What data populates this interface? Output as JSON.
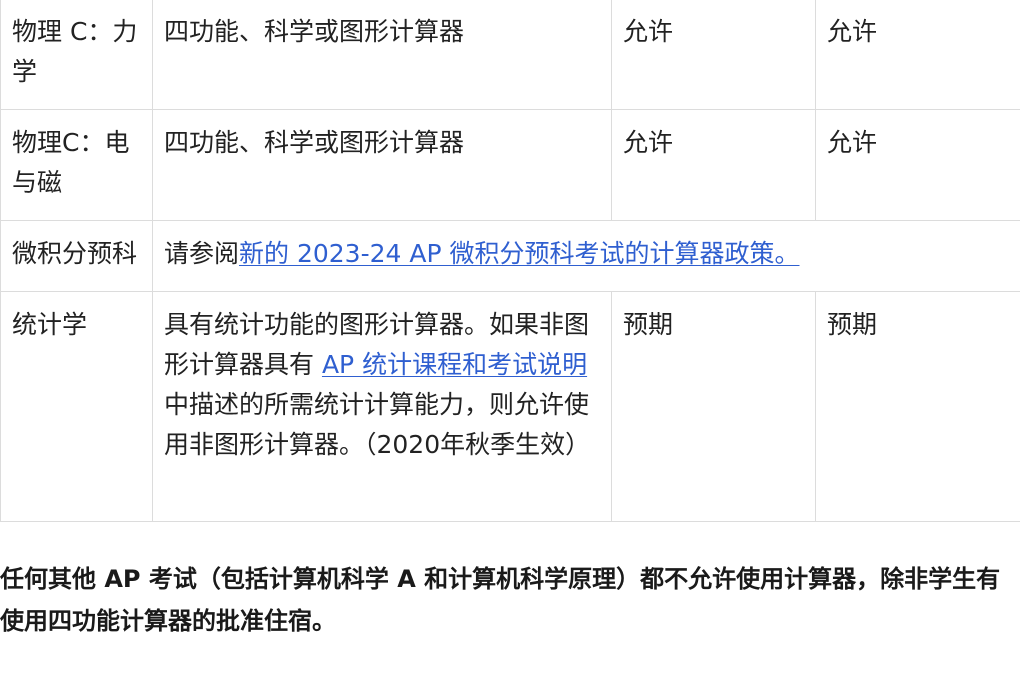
{
  "table": {
    "rows": [
      {
        "subject": "物理 C：力学",
        "calculator": "四功能、科学或图形计算器",
        "col3": "允许",
        "col4": "允许"
      },
      {
        "subject": "物理C：电与磁",
        "calculator": "四功能、科学或图形计算器",
        "col3": "允许",
        "col4": "允许"
      },
      {
        "subject": "微积分预科",
        "text_before": "请参阅",
        "link": "新的 2023-24 AP 微积分预科考试的计算器政策。"
      },
      {
        "subject": "统计学",
        "text_before": "具有统计功能的图形计算器。如果非图形计算器具有 ",
        "link": "AP 统计课程和考试说明",
        "text_after": "中描述的所需统计计算能力，则允许使用非图形计算器。（2020年秋季生效）",
        "col3": "预期",
        "col4": "预期"
      }
    ]
  },
  "note": "任何其他 AP 考试（包括计算机科学 A 和计算机科学原理）都不允许使用计算器，除非学生有使用四功能计算器的批准住宿。"
}
